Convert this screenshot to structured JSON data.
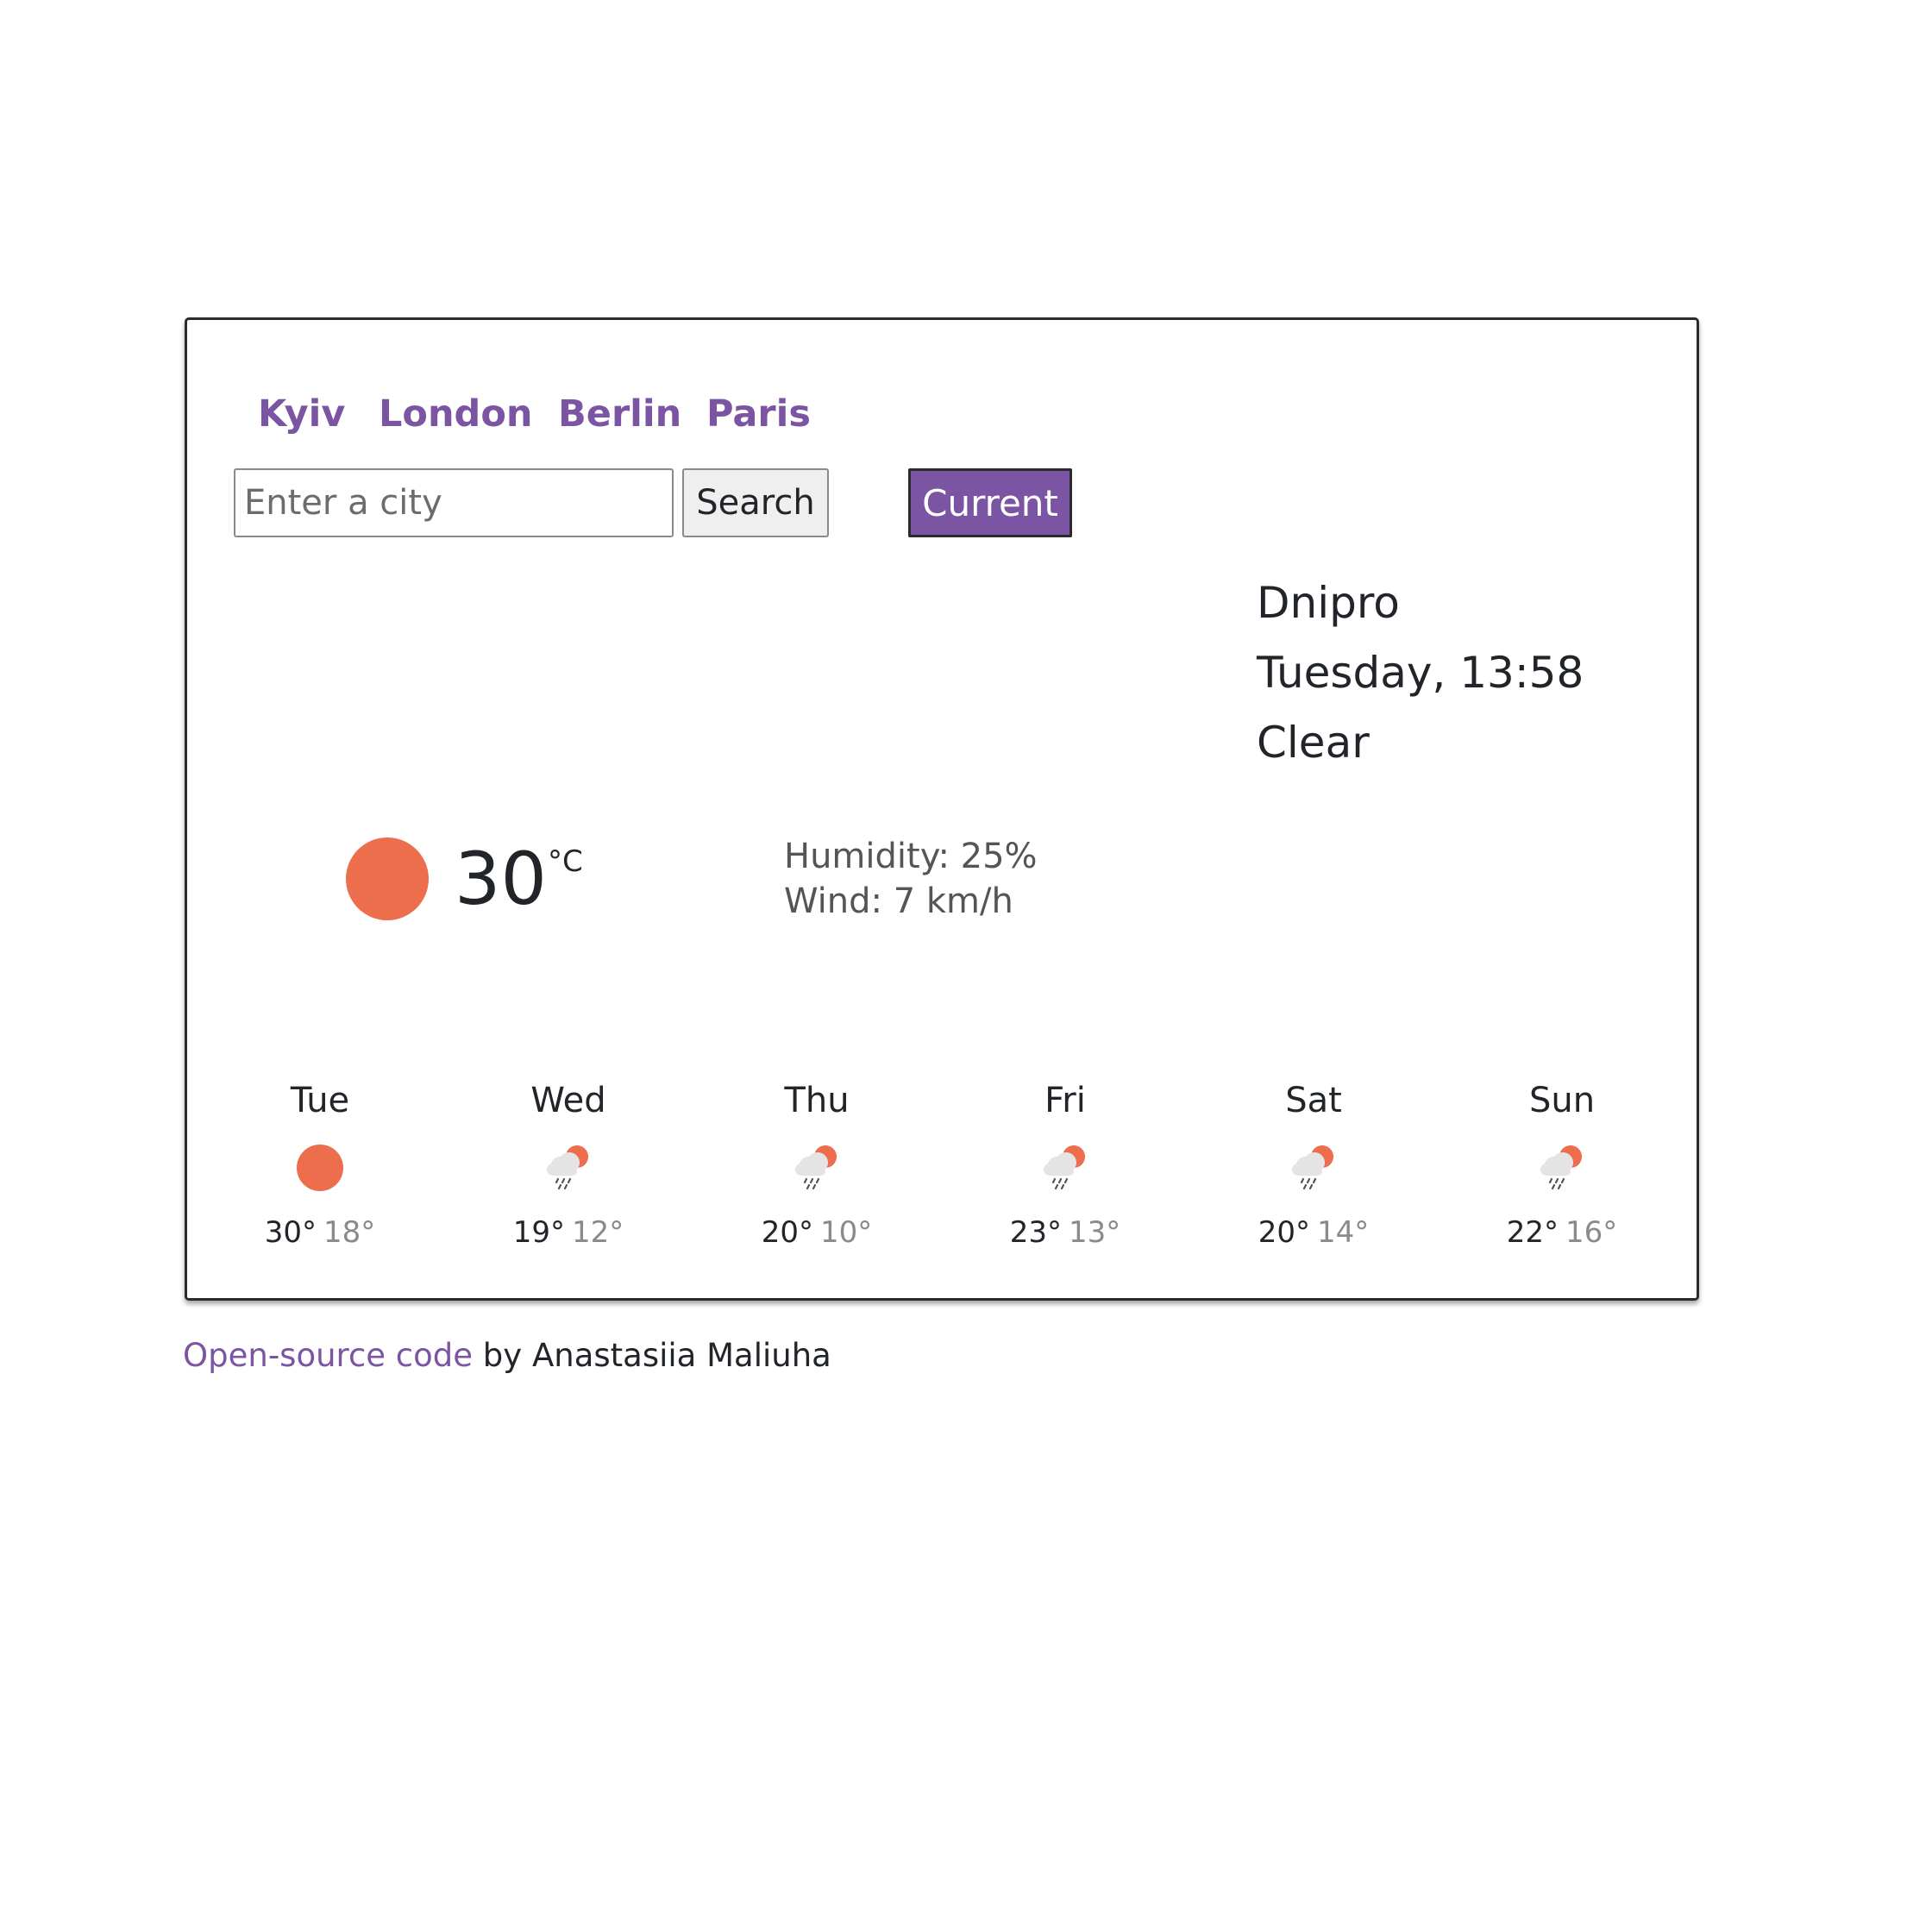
{
  "cities": [
    "Kyiv",
    "London",
    "Berlin",
    "Paris"
  ],
  "search": {
    "placeholder": "Enter a city",
    "value": "",
    "button_label": "Search"
  },
  "current_button_label": "Current",
  "location": {
    "city": "Dnipro",
    "datetime": "Tuesday, 13:58",
    "description": "Clear"
  },
  "current": {
    "temperature": "30",
    "unit": "°C",
    "icon": "sun-icon",
    "humidity": "Humidity: 25%",
    "wind": "Wind: 7 km/h"
  },
  "forecast": [
    {
      "day": "Tue",
      "max": "30°",
      "min": "18°",
      "icon": "sun-icon"
    },
    {
      "day": "Wed",
      "max": "19°",
      "min": "12°",
      "icon": "rain-sun-icon"
    },
    {
      "day": "Thu",
      "max": "20°",
      "min": "10°",
      "icon": "rain-sun-icon"
    },
    {
      "day": "Fri",
      "max": "23°",
      "min": "13°",
      "icon": "rain-sun-icon"
    },
    {
      "day": "Sat",
      "max": "20°",
      "min": "14°",
      "icon": "rain-sun-icon"
    },
    {
      "day": "Sun",
      "max": "22°",
      "min": "16°",
      "icon": "rain-sun-icon"
    }
  ],
  "footer": {
    "link_text": "Open-source code",
    "suffix": " by Anastasiia Maliuha"
  },
  "colors": {
    "accent": "#7b55a3",
    "sun": "#ec6e4c",
    "cloud": "#e4e4e4",
    "text": "#212529",
    "muted": "#8a8a8a"
  }
}
